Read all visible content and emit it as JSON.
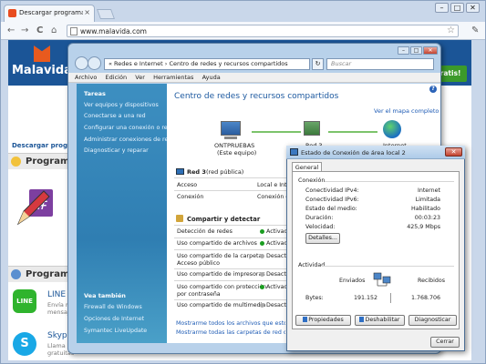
{
  "browser": {
    "tab_title": "Descargar programas gra",
    "tab_close": "×",
    "url": "www.malavida.com",
    "back": "←",
    "forward": "→",
    "reload": "C",
    "home": "⌂",
    "star": "☆",
    "menu": "✎",
    "win_min": "–",
    "win_max": "□",
    "win_close": "✕"
  },
  "malavida": {
    "logo_text": "Malavida",
    "green_button": "Gratis!",
    "subheading": "Descargar programa",
    "section1": "Programa",
    "section2": "Programa",
    "apps": [
      {
        "name": "LINE",
        "desc1": "Envía m",
        "desc2": "mensaje"
      },
      {
        "name": "Skype",
        "desc1": "Llama y",
        "desc2": "gratuitas"
      }
    ],
    "line_icon_text": "LINE",
    "skype_icon_text": "S"
  },
  "nsc": {
    "address": "« Redes e Internet › Centro de redes y recursos compartidos",
    "refresh": "↻",
    "search_placeholder": "Buscar",
    "menu": [
      "Archivo",
      "Edición",
      "Ver",
      "Herramientas",
      "Ayuda"
    ],
    "tasks_heading": "Tareas",
    "tasks": [
      "Ver equipos y dispositivos",
      "Conectarse a una red",
      "Configurar una conexión o red",
      "Administrar conexiones de red",
      "Diagnosticar y reparar"
    ],
    "see_also_heading": "Vea también",
    "see_also": [
      "Firewall de Windows",
      "Opciones de Internet",
      "Symantec LiveUpdate"
    ],
    "help": "?",
    "title": "Centro de redes y recursos compartidos",
    "full_map": "Ver el mapa completo",
    "map_nodes": [
      {
        "name": "ONTPRUEBAS",
        "sub": "(Este equipo)"
      },
      {
        "name": "Red 3",
        "sub": ""
      },
      {
        "name": "Internet",
        "sub": ""
      }
    ],
    "network_name": "Red 3",
    "network_type": "(red pública)",
    "access_label": "Acceso",
    "access_value": "Local e Intern",
    "connection_label": "Conexión",
    "connection_value": "Conexión de á",
    "sharing_heading": "Compartir y detectar",
    "sharing_rows": [
      {
        "label": "Detección de redes",
        "status": "Activado"
      },
      {
        "label": "Uso compartido de archivos",
        "status": "Activado"
      },
      {
        "label": "Uso compartido de la carpeta",
        "label2": "Acceso público",
        "status": "Desactivado"
      },
      {
        "label": "Uso compartido de impresoras",
        "status": "Desactivado"
      },
      {
        "label": "Uso compartido con protección",
        "label2": "por contraseña",
        "status": "Activado"
      },
      {
        "label": "Uso compartido de multimedia",
        "status": "Desactivado"
      }
    ],
    "bottom_links": [
      "Mostrarme todos los archivos que estoy com",
      "Mostrarme todas las carpetas de red compart"
    ]
  },
  "dialog": {
    "title": "Estado de Conexión de área local 2",
    "close": "✕",
    "tab": "General",
    "connection_heading": "Conexión",
    "rows": [
      {
        "key": "Conectividad IPv4:",
        "value": "Internet"
      },
      {
        "key": "Conectividad IPv6:",
        "value": "Limitada"
      },
      {
        "key": "Estado del medio:",
        "value": "Habilitado"
      },
      {
        "key": "Duración:",
        "value": "00:03:23"
      },
      {
        "key": "Velocidad:",
        "value": "425,9 Mbps"
      }
    ],
    "details_button": "Detalles...",
    "activity_heading": "Actividad",
    "sent_label": "Enviados",
    "received_label": "Recibidos",
    "bytes_label": "Bytes:",
    "bytes_sent": "191.152",
    "bytes_received": "1.768.706",
    "properties_button": "Propiedades",
    "disable_button": "Deshabilitar",
    "diagnose_button": "Diagnosticar",
    "close_button": "Cerrar"
  }
}
